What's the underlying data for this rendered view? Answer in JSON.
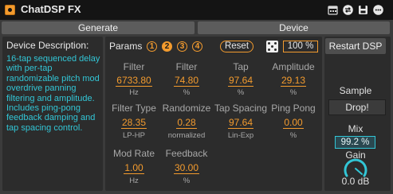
{
  "title": "ChatDSP FX",
  "colors": {
    "accent": "#f39b2e",
    "cyan": "#32c6d6",
    "panel": "#2c2c2c"
  },
  "title_icons": [
    "calendar-icon",
    "swap-icon",
    "save-icon",
    "menu-dots-icon"
  ],
  "tabs": {
    "generate": "Generate",
    "device": "Device"
  },
  "description": {
    "title": "Device Description:",
    "text": "16-tap sequenced delay with per-tap randomizable pitch mod overdrive panning filtering and amplitude. Includes ping-pong feedback damping and tap spacing control."
  },
  "params": {
    "label": "Params",
    "pages": [
      "1",
      "2",
      "3",
      "4"
    ],
    "active_page": "2",
    "reset_label": "Reset",
    "random_amount": "100 %",
    "items": [
      {
        "name": "Filter",
        "value": "6733.80",
        "unit": "Hz"
      },
      {
        "name": "Filter",
        "value": "74.80",
        "unit": "%"
      },
      {
        "name": "Tap",
        "value": "97.64",
        "unit": "%"
      },
      {
        "name": "Amplitude",
        "value": "29.13",
        "unit": "%"
      },
      {
        "name": "Filter Type",
        "value": "28.35",
        "unit": "LP-HP"
      },
      {
        "name": "Randomize",
        "value": "0.28",
        "unit": "normalized"
      },
      {
        "name": "Tap Spacing",
        "value": "97.64",
        "unit": "Lin-Exp"
      },
      {
        "name": "Ping Pong",
        "value": "0.00",
        "unit": "%"
      },
      {
        "name": "Mod Rate",
        "value": "1.00",
        "unit": "Hz"
      },
      {
        "name": "Feedback",
        "value": "30.00",
        "unit": "%"
      }
    ]
  },
  "right": {
    "restart": "Restart DSP",
    "sample_label": "Sample",
    "drop_label": "Drop!",
    "mix_label": "Mix",
    "mix_value": "99.2 %",
    "mix_fraction": 0.992,
    "gain_label": "Gain",
    "gain_value": "0.0 dB"
  }
}
